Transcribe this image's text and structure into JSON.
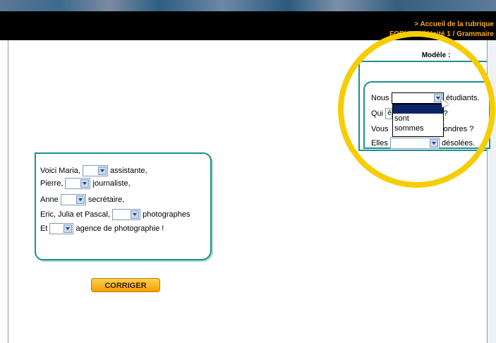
{
  "header": {
    "home_link": "> Accueil de la rubrique",
    "breadcrumb": "FORUM 1 / Unité 1 / Grammaire"
  },
  "exercise": {
    "lines": [
      {
        "before": "Voici Maria,",
        "after": "assistante,"
      },
      {
        "before": "Pierre,",
        "after": "journaliste,"
      },
      {
        "before": "Anne",
        "after": "secrétaire,"
      },
      {
        "before": "Eric, Julia et Pascal,",
        "after": "photographes"
      },
      {
        "before": "Et",
        "after": "agence de photographie !"
      }
    ],
    "button_label": "CORRIGER"
  },
  "model": {
    "title": "Modèle :",
    "lines": [
      {
        "before": "Nous",
        "after": "étudiants."
      },
      {
        "before": "Qui",
        "after": "t ?"
      },
      {
        "before": "Vous",
        "after": "ondres ?"
      },
      {
        "before": "Elles",
        "after": "désolées."
      }
    ],
    "partial_value": "ê",
    "dropdown_options": [
      "sont",
      "sommes"
    ]
  },
  "colors": {
    "accent": "#1f8f8f",
    "highlight": "#f5cd00",
    "nav_text": "#f7a825",
    "button": "#f5a000"
  }
}
